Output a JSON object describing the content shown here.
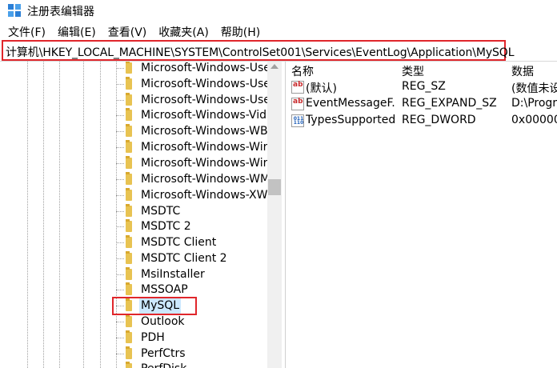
{
  "window": {
    "title": "注册表编辑器",
    "icon": "registry-editor-icon"
  },
  "menu": [
    {
      "label": "文件(F)"
    },
    {
      "label": "编辑(E)"
    },
    {
      "label": "查看(V)"
    },
    {
      "label": "收藏夹(A)"
    },
    {
      "label": "帮助(H)"
    }
  ],
  "address": {
    "path": "计算机\\HKEY_LOCAL_MACHINE\\SYSTEM\\ControlSet001\\Services\\EventLog\\Application\\MySQL"
  },
  "tree": {
    "items": [
      {
        "label": "Microsoft-Windows-Use"
      },
      {
        "label": "Microsoft-Windows-Use"
      },
      {
        "label": "Microsoft-Windows-Use"
      },
      {
        "label": "Microsoft-Windows-Vid"
      },
      {
        "label": "Microsoft-Windows-WB"
      },
      {
        "label": "Microsoft-Windows-Wir"
      },
      {
        "label": "Microsoft-Windows-Wir"
      },
      {
        "label": "Microsoft-Windows-WM"
      },
      {
        "label": "Microsoft-Windows-XW"
      },
      {
        "label": "MSDTC"
      },
      {
        "label": "MSDTC 2"
      },
      {
        "label": "MSDTC Client"
      },
      {
        "label": "MSDTC Client 2"
      },
      {
        "label": "MsiInstaller"
      },
      {
        "label": "MSSOAP"
      },
      {
        "label": "MySQL",
        "selected": true
      },
      {
        "label": "Outlook"
      },
      {
        "label": "PDH"
      },
      {
        "label": "PerfCtrs"
      },
      {
        "label": "PerfDisk"
      }
    ]
  },
  "values": {
    "columns": {
      "name": "名称",
      "type": "类型",
      "data": "数据"
    },
    "rows": [
      {
        "icon": "string-value-icon",
        "name": "(默认)",
        "type": "REG_SZ",
        "data": "(数值未设"
      },
      {
        "icon": "string-value-icon",
        "name": "EventMessageF...",
        "type": "REG_EXPAND_SZ",
        "data": "D:\\Progra"
      },
      {
        "icon": "binary-value-icon",
        "name": "TypesSupported",
        "type": "REG_DWORD",
        "data": "0x00000"
      }
    ]
  },
  "colors": {
    "highlight_border": "#e0262b",
    "selection": "#cce8ff",
    "folder": "#e8c352"
  }
}
